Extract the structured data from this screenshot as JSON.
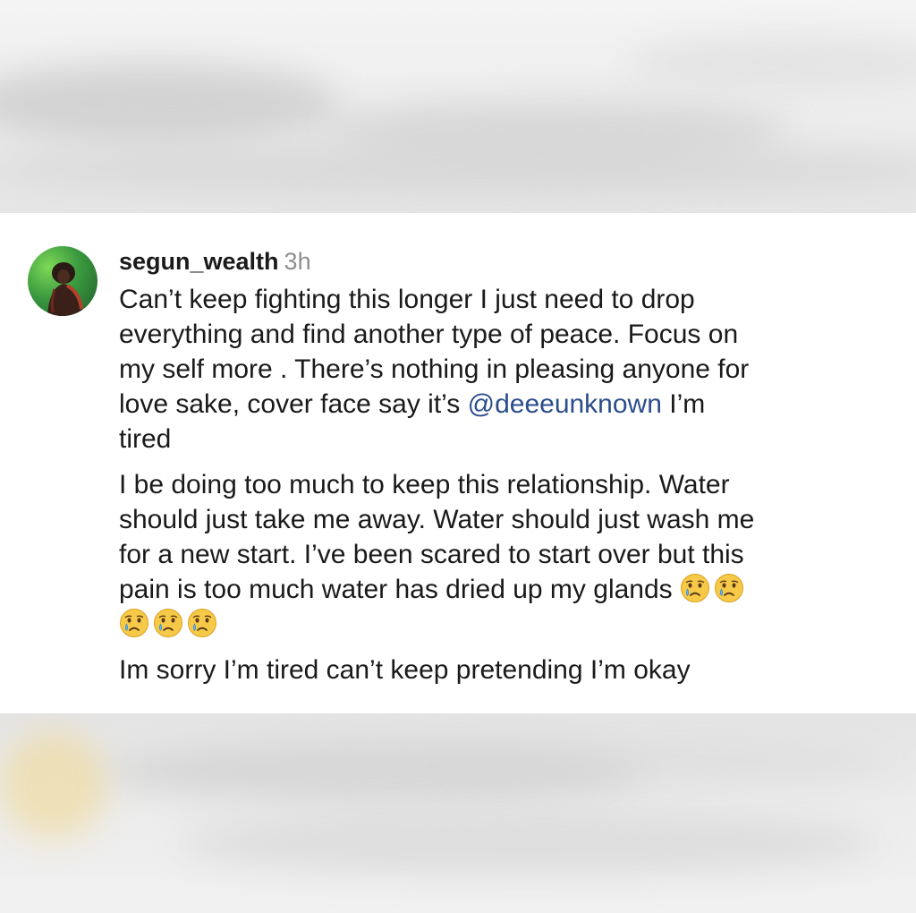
{
  "comment": {
    "username": "segun_wealth",
    "timestamp": "3h",
    "avatar_icon": "profile-photo-avatar",
    "paragraph1": {
      "lines": [
        "Can’t keep fighting this longer I just need to drop",
        "everything and find another type of peace. Focus on",
        "my self more . There’s nothing in pleasing anyone for"
      ],
      "line4_before": "love sake, cover face say it’s ",
      "mention": "@deeeunknown",
      "line4_after": " I’m",
      "line5": "tired"
    },
    "paragraph2": {
      "lines": [
        "I be doing too much to keep this relationship. Water",
        "should just take me away. Water should just wash me",
        "for a new start. I’ve been scared to start over but this"
      ],
      "line4": "pain is too much water has dried up my glands ",
      "emoji_icon": "crying-face-emoji"
    },
    "paragraph3": "Im sorry I’m tired can’t keep pretending I’m okay"
  },
  "colors": {
    "username": "#1a1a1a",
    "timestamp": "#8e8e8e",
    "mention": "#2b4d8c",
    "card_background": "#ffffff",
    "emoji_face": "#f7c948"
  }
}
